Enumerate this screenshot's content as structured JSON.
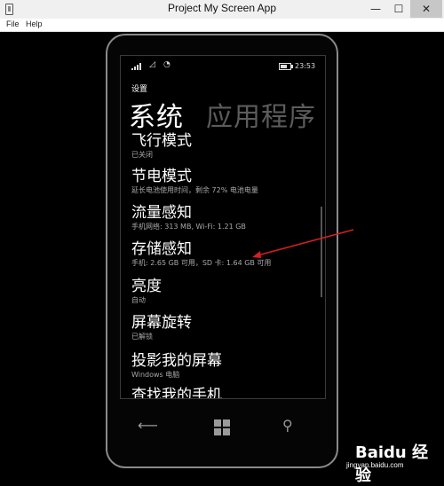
{
  "window": {
    "title": "Project My Screen App",
    "minimize_glyph": "—",
    "maximize_glyph": "☐",
    "close_glyph": "✕"
  },
  "menu": {
    "file": "File",
    "help": "Help"
  },
  "phone": {
    "status": {
      "time": "23:53"
    },
    "breadcrumb": "设置",
    "pivot": {
      "current": "系统",
      "next": "应用程序"
    },
    "items": [
      {
        "title": "飞行模式",
        "subtitle": "已关闭"
      },
      {
        "title": "节电模式",
        "subtitle": "延长电池使用时间，剩余 72% 电池电量"
      },
      {
        "title": "流量感知",
        "subtitle": "手机网络: 313 MB, Wi-Fi: 1.21 GB"
      },
      {
        "title": "存储感知",
        "subtitle": "手机: 2.65 GB 可用，SD 卡: 1.64 GB 可用"
      },
      {
        "title": "亮度",
        "subtitle": "自动"
      },
      {
        "title": "屏幕旋转",
        "subtitle": "已解锁"
      },
      {
        "title": "投影我的屏幕",
        "subtitle": "Windows 电脑"
      },
      {
        "title": "查找我的手机",
        "subtitle": ""
      }
    ],
    "nav": {
      "back_glyph": "⟵",
      "search_glyph": "⚲"
    }
  },
  "watermark": {
    "brand": "Baidu 经验",
    "url": "jingyan.baidu.com"
  },
  "colors": {
    "background": "#000000",
    "accent_arrow": "#d42020",
    "subtitle": "#a8a8a8",
    "inactive_pivot": "#5c5c5c"
  }
}
